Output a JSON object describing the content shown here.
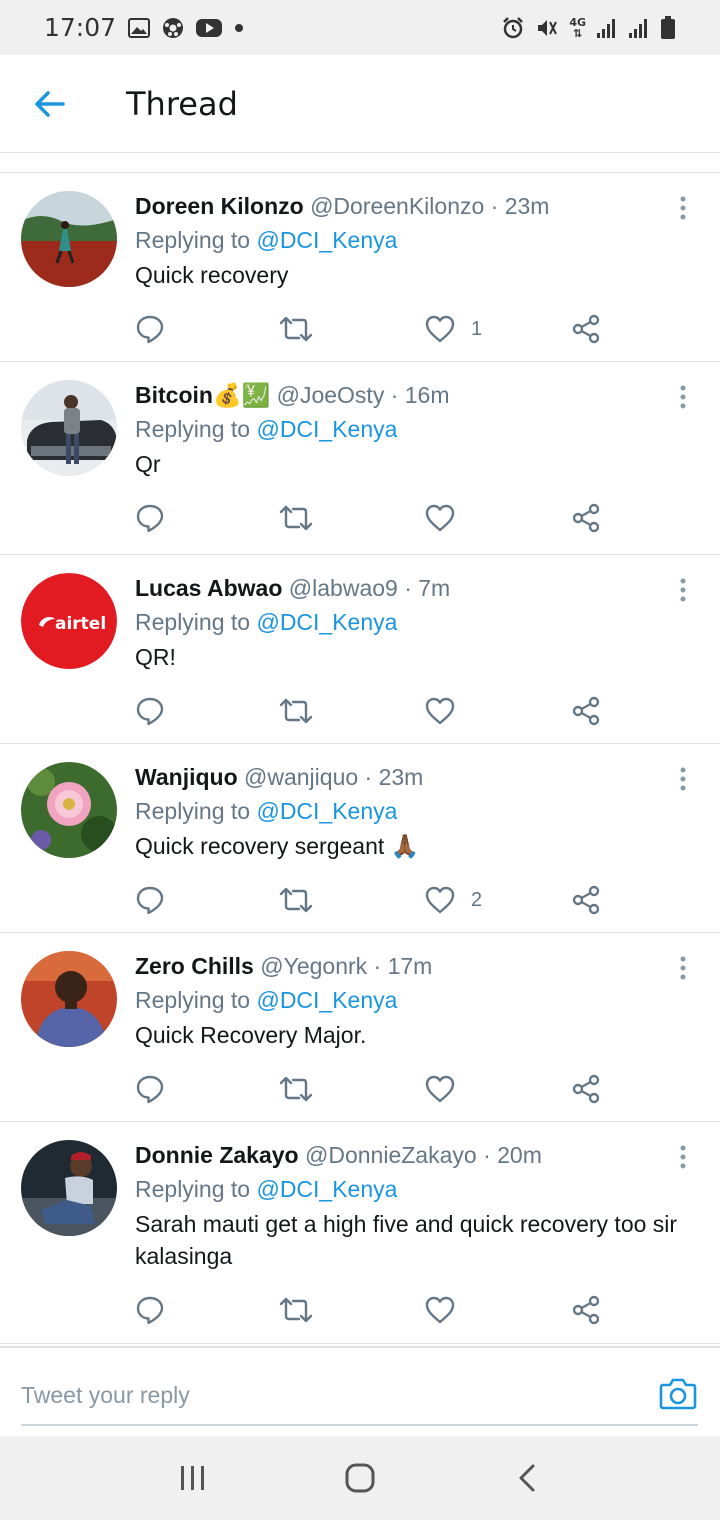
{
  "status_bar": {
    "time": "17:07",
    "left_icons": [
      "image-icon",
      "soccer-icon",
      "youtube-icon",
      "dot-icon"
    ],
    "right_icons": [
      "alarm-icon",
      "mute-icon",
      "network-4g-icon",
      "signal-icon",
      "signal-icon",
      "battery-icon"
    ],
    "network_label": "4G"
  },
  "app_bar": {
    "title": "Thread",
    "back_icon": "back-arrow-icon"
  },
  "colors": {
    "accent": "#1b95e0",
    "text": "#14171a",
    "secondary": "#657786",
    "divider": "#dde2e6",
    "background": "#ffffff"
  },
  "tweets": [
    {
      "name": "Doreen Kilonzo",
      "handle": "@DoreenKilonzo",
      "time": "· 23m",
      "replying_prefix": "Replying to ",
      "mention": "@DCI_Kenya",
      "text": "Quick recovery",
      "likes": "1",
      "avatar": "photo-field"
    },
    {
      "name": "Bitcoin💰💹",
      "handle": "@JoeOsty",
      "time": "· 16m",
      "replying_prefix": "Replying to ",
      "mention": "@DCI_Kenya",
      "text": "Qr",
      "likes": "",
      "avatar": "photo-car"
    },
    {
      "name": "Lucas Abwao",
      "handle": "@labwao9",
      "time": "· 7m",
      "replying_prefix": "Replying to ",
      "mention": "@DCI_Kenya",
      "text": "QR!",
      "likes": "",
      "avatar": "airtel-logo",
      "avatar_label": "airtel"
    },
    {
      "name": "Wanjiquo",
      "handle": "@wanjiquo",
      "time": "· 23m",
      "replying_prefix": "Replying to ",
      "mention": "@DCI_Kenya",
      "text": "Quick recovery sergeant 🙏🏾",
      "likes": "2",
      "avatar": "photo-flower"
    },
    {
      "name": "Zero Chills",
      "handle": "@Yegonrk",
      "time": "· 17m",
      "replying_prefix": "Replying to ",
      "mention": "@DCI_Kenya",
      "text": "Quick Recovery Major.",
      "likes": "",
      "avatar": "photo-man-blue"
    },
    {
      "name": "Donnie Zakayo",
      "handle": "@DonnieZakayo",
      "time": "· 20m",
      "replying_prefix": "Replying to ",
      "mention": "@DCI_Kenya",
      "text": "Sarah mauti get a high five and quick recovery too sir kalasinga",
      "likes": "",
      "avatar": "photo-man-sitting"
    }
  ],
  "composer": {
    "placeholder": "Tweet your reply",
    "camera_icon": "camera-icon"
  },
  "nav_bar": {
    "icons": [
      "recent-apps-icon",
      "home-icon",
      "back-icon"
    ]
  }
}
